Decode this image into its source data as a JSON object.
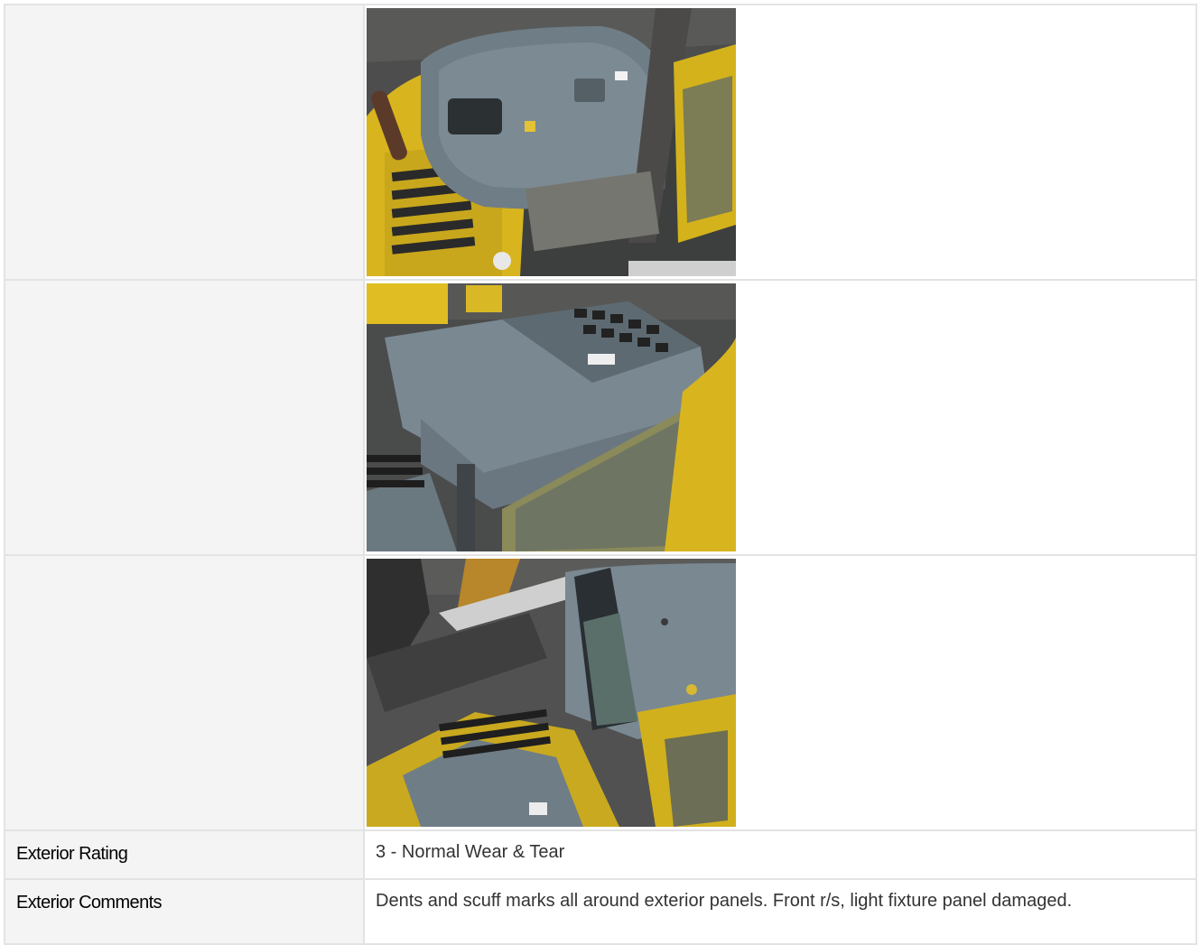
{
  "photos": [
    {
      "name": "excavator-engine-hood-photo"
    },
    {
      "name": "excavator-cab-roof-photo"
    },
    {
      "name": "excavator-cab-side-photo"
    }
  ],
  "fields": {
    "exterior_rating_label": "Exterior Rating",
    "exterior_rating_value": "3 - Normal Wear & Tear",
    "exterior_comments_label": "Exterior Comments",
    "exterior_comments_value": "Dents and scuff marks all around exterior panels. Front r/s, light fixture panel damaged."
  },
  "colors": {
    "label_background": "#f4f4f4",
    "border": "#e3e3e3",
    "machine_yellow": "#e2c22a",
    "panel_grey": "#6f7d86"
  }
}
